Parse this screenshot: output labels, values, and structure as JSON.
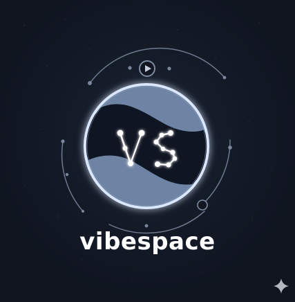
{
  "brand": {
    "name": "vibespace",
    "monogram": "VS"
  },
  "icons": {
    "play": "play-icon",
    "sparkle": "sparkle-icon"
  },
  "colors": {
    "background": "#111622",
    "ring_glow": "#dbe7ff",
    "planet_wave": "#6f84a4",
    "planet_core": "#101522",
    "text": "#ffffff"
  }
}
